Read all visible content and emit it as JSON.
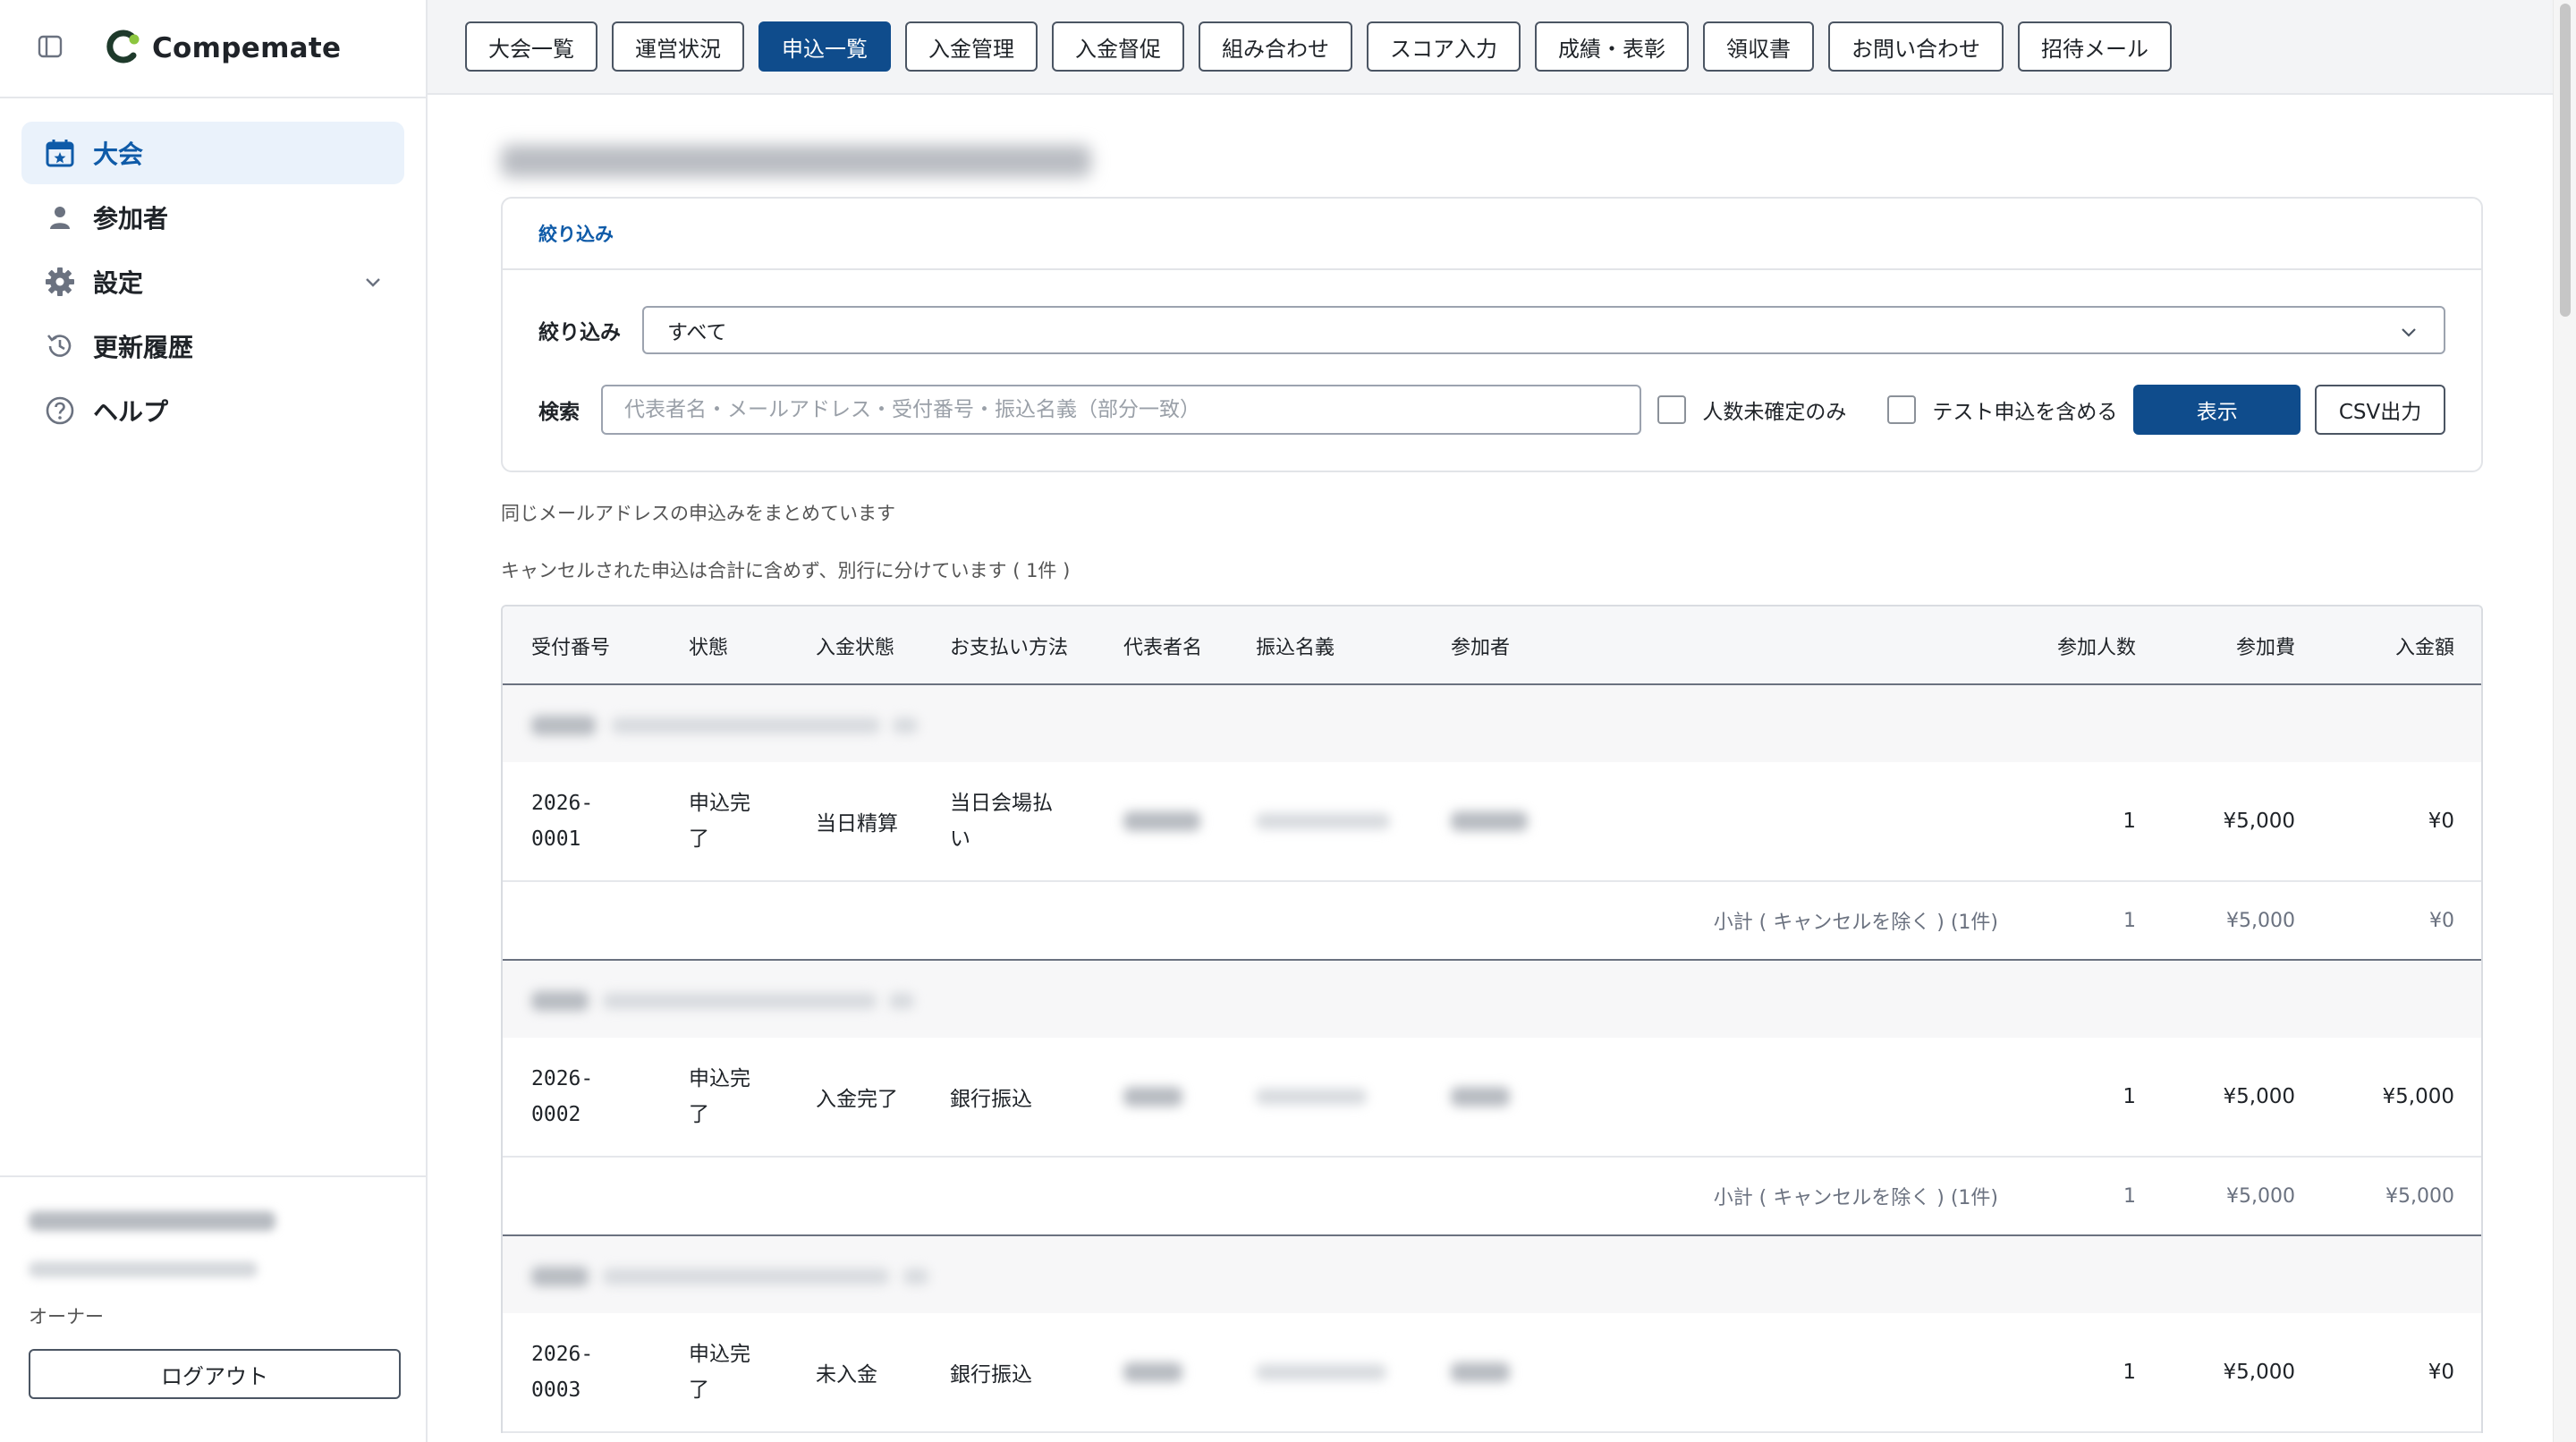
{
  "app": {
    "name": "Compemate"
  },
  "sidebar": {
    "items": [
      {
        "label": "大会",
        "icon": "calendar-icon",
        "active": true
      },
      {
        "label": "参加者",
        "icon": "person-icon"
      },
      {
        "label": "設定",
        "icon": "gear-icon"
      },
      {
        "label": "更新履歴",
        "icon": "history-icon"
      },
      {
        "label": "ヘルプ",
        "icon": "help-icon"
      }
    ],
    "footer": {
      "role": "オーナー",
      "logout_label": "ログアウト"
    }
  },
  "tabs": [
    {
      "label": "大会一覧"
    },
    {
      "label": "運営状況"
    },
    {
      "label": "申込一覧",
      "active": true
    },
    {
      "label": "入金管理"
    },
    {
      "label": "入金督促"
    },
    {
      "label": "組み合わせ"
    },
    {
      "label": "スコア入力"
    },
    {
      "label": "成績・表彰"
    },
    {
      "label": "領収書"
    },
    {
      "label": "お問い合わせ"
    },
    {
      "label": "招待メール"
    }
  ],
  "filter": {
    "header": "絞り込み",
    "filter_label": "絞り込み",
    "filter_value": "すべて",
    "search_label": "検索",
    "search_placeholder": "代表者名・メールアドレス・受付番号・振込名義（部分一致）",
    "checkbox_unconfirmed": "人数未確定のみ",
    "checkbox_include_test": "テスト申込を含める",
    "show_button": "表示",
    "csv_button": "CSV出力"
  },
  "notes": {
    "merged": "同じメールアドレスの申込みをまとめています",
    "cancelled": "キャンセルされた申込は合計に含めず、別行に分けています ( 1件 )"
  },
  "table": {
    "headers": {
      "receipt_no": "受付番号",
      "status": "状態",
      "payment_status": "入金状態",
      "payment_method": "お支払い方法",
      "representative": "代表者名",
      "transfer_name": "振込名義",
      "participants": "参加者",
      "count": "参加人数",
      "fee": "参加費",
      "paid": "入金額"
    },
    "groups": [
      {
        "row": {
          "receipt_no": "2026-\n0001",
          "status": "申込完了",
          "payment_status": "当日精算",
          "payment_method": "当日会場払い",
          "count": "1",
          "fee": "¥5,000",
          "paid": "¥0"
        },
        "subtotal": {
          "label": "小計 ( キャンセルを除く ) (1件)",
          "count": "1",
          "fee": "¥5,000",
          "paid": "¥0"
        }
      },
      {
        "row": {
          "receipt_no": "2026-\n0002",
          "status": "申込完了",
          "payment_status": "入金完了",
          "payment_method": "銀行振込",
          "count": "1",
          "fee": "¥5,000",
          "paid": "¥5,000"
        },
        "subtotal": {
          "label": "小計 ( キャンセルを除く ) (1件)",
          "count": "1",
          "fee": "¥5,000",
          "paid": "¥5,000"
        }
      },
      {
        "row": {
          "receipt_no": "2026-\n0003",
          "status": "申込完了",
          "payment_status": "未入金",
          "payment_method": "銀行振込",
          "count": "1",
          "fee": "¥5,000",
          "paid": "¥0"
        }
      }
    ]
  },
  "colors": {
    "accent": "#0f4c8c",
    "accent_text": "#0f5ba8",
    "active_bg": "#eaf2fb",
    "logo_green": "#8cc63f",
    "logo_dark": "#1e3a2b"
  }
}
